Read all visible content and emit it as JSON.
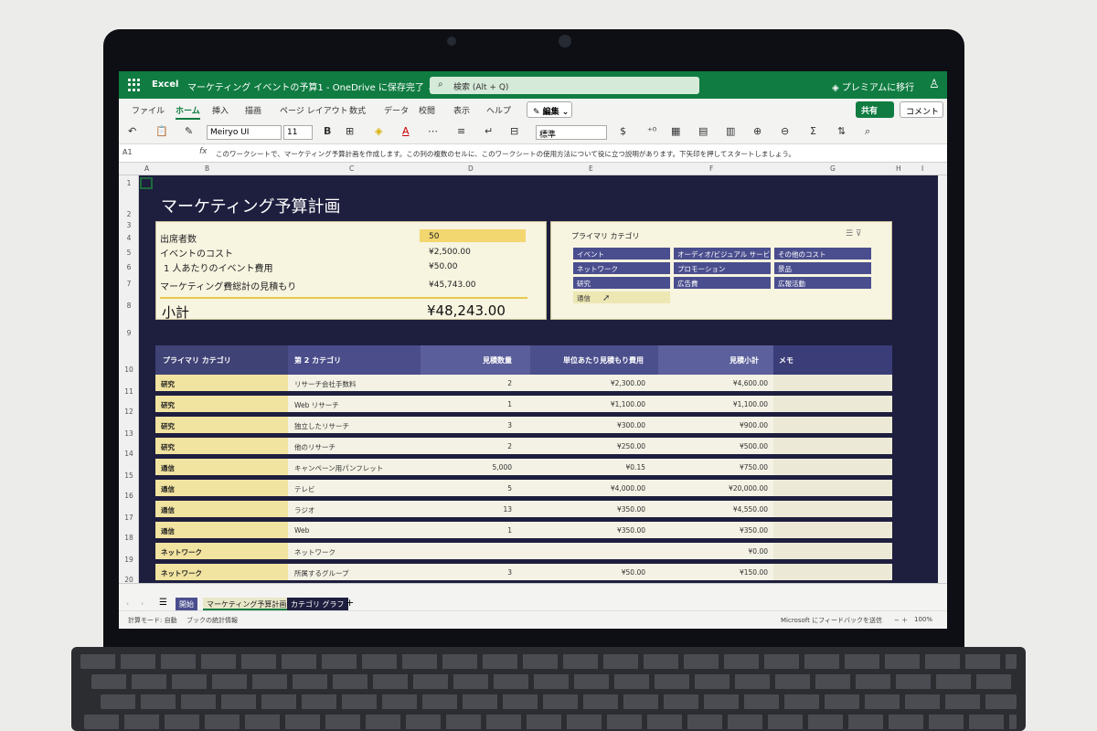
{
  "titlebar": {
    "app": "Excel",
    "doc_title": "マーケティング イベントの予算1 - OneDrive に保存完了 ⌄",
    "search_placeholder": "検索 (Alt + Q)",
    "premium": "プレミアムに移行"
  },
  "ribbon": {
    "tabs": [
      "ファイル",
      "ホーム",
      "挿入",
      "描画",
      "ページ レイアウト",
      "数式",
      "データ",
      "校閲",
      "表示",
      "ヘルプ"
    ],
    "edit_mode": "✎ 編集 ⌄",
    "share": "共有",
    "comment": "コメント"
  },
  "toolbar": {
    "font_name": "Meiryo UI",
    "font_size": "11",
    "number_format": "標準"
  },
  "formula_bar": {
    "name_box": "A1",
    "fx": "fx",
    "content": "このワークシートで、マーケティング予算計画を作成します。この列の複数のセルに、このワークシートの使用方法について役に立つ説明があります。下矢印を押してスタートしましょう。"
  },
  "grid": {
    "columns": [
      "A",
      "B",
      "C",
      "D",
      "E",
      "F",
      "G",
      "H",
      "I"
    ],
    "rows": [
      "1",
      "2",
      "3",
      "4",
      "5",
      "6",
      "7",
      "8",
      "9",
      "10",
      "11",
      "12",
      "13",
      "14",
      "15",
      "16",
      "17",
      "18",
      "19",
      "20"
    ]
  },
  "sheet": {
    "title": "マーケティング予算計画",
    "summary": {
      "attendees_label": "出席者数",
      "attendees_value": "50",
      "event_cost_label": "イベントのコスト",
      "event_cost_value": "¥2,500.00",
      "per_person_label": "1 人あたりのイベント費用",
      "per_person_value": "¥50.00",
      "marketing_total_label": "マーケティング費総計の見積もり",
      "marketing_total_value": "¥45,743.00",
      "subtotal_label": "小計",
      "subtotal_value": "¥48,243.00"
    },
    "slicer": {
      "title": "プライマリ カテゴリ",
      "tools": "☰ ⊽",
      "items": [
        {
          "label": "イベント",
          "selected": true
        },
        {
          "label": "オーディオ/ビジュアル サービス",
          "selected": true
        },
        {
          "label": "その他のコスト",
          "selected": true
        },
        {
          "label": "ネットワーク",
          "selected": true
        },
        {
          "label": "プロモーション",
          "selected": true
        },
        {
          "label": "景品",
          "selected": true
        },
        {
          "label": "研究",
          "selected": true
        },
        {
          "label": "広告費",
          "selected": true
        },
        {
          "label": "広報活動",
          "selected": true
        },
        {
          "label": "通信",
          "selected": false
        }
      ]
    },
    "table": {
      "headers": {
        "primary": "プライマリ カテゴリ",
        "secondary": "第 2 カテゴリ",
        "qty": "見積数量",
        "unit_cost": "単位あたり見積もり費用",
        "subtotal": "見積小計",
        "memo": "メモ"
      },
      "rows": [
        {
          "primary": "研究",
          "secondary": "リサーチ会社手数料",
          "qty": "2",
          "unit": "¥2,300.00",
          "total": "¥4,600.00"
        },
        {
          "primary": "研究",
          "secondary": "Web リサーチ",
          "qty": "1",
          "unit": "¥1,100.00",
          "total": "¥1,100.00"
        },
        {
          "primary": "研究",
          "secondary": "独立したリサーチ",
          "qty": "3",
          "unit": "¥300.00",
          "total": "¥900.00"
        },
        {
          "primary": "研究",
          "secondary": "他のリサーチ",
          "qty": "2",
          "unit": "¥250.00",
          "total": "¥500.00"
        },
        {
          "primary": "通信",
          "secondary": "キャンペーン用パンフレット",
          "qty": "5,000",
          "unit": "¥0.15",
          "total": "¥750.00"
        },
        {
          "primary": "通信",
          "secondary": "テレビ",
          "qty": "5",
          "unit": "¥4,000.00",
          "total": "¥20,000.00"
        },
        {
          "primary": "通信",
          "secondary": "ラジオ",
          "qty": "13",
          "unit": "¥350.00",
          "total": "¥4,550.00"
        },
        {
          "primary": "通信",
          "secondary": "Web",
          "qty": "1",
          "unit": "¥350.00",
          "total": "¥350.00"
        },
        {
          "primary": "ネットワーク",
          "secondary": "ネットワーク",
          "qty": "",
          "unit": "",
          "total": "¥0.00"
        },
        {
          "primary": "ネットワーク",
          "secondary": "所属するグループ",
          "qty": "3",
          "unit": "¥50.00",
          "total": "¥150.00"
        }
      ]
    }
  },
  "sheet_tabs": [
    "開始",
    "マーケティング予算計画",
    "カテゴリ グラフ"
  ],
  "statusbar": {
    "calc_mode": "計算モード: 自動",
    "workbook_stats": "ブックの統計情報",
    "feedback": "Microsoft にフィードバックを送信",
    "zoom": "100%"
  },
  "colors": {
    "excel_green": "#107c41",
    "sheet_bg": "#1e1e3f",
    "header_navy": "#3a3d78",
    "category_yellow": "#f1e3a0"
  }
}
